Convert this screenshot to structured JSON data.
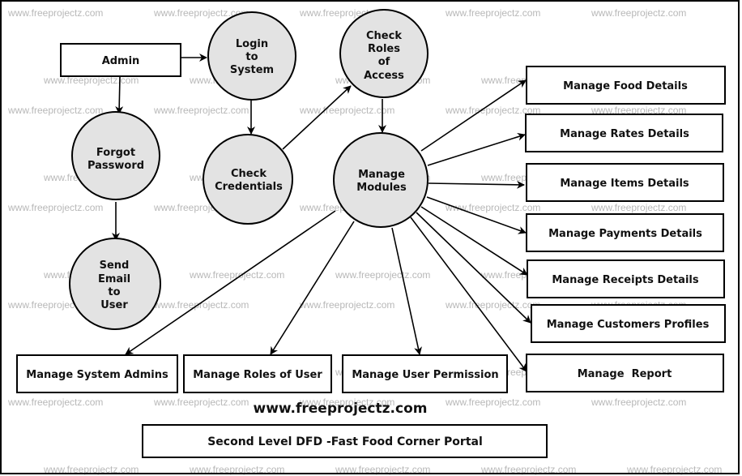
{
  "diagram": {
    "title": "Second Level DFD -Fast Food Corner Portal",
    "website": "www.freeprojectz.com",
    "watermark": "www.freeprojectz.com",
    "entities": {
      "admin": "Admin",
      "manage_food": "Manage Food Details",
      "manage_rates": "Manage Rates Details",
      "manage_items": "Manage Items Details",
      "manage_payments": "Manage Payments Details",
      "manage_receipts": "Manage Receipts Details",
      "manage_customers": "Manage Customers Profiles",
      "manage_report": "Manage  Report",
      "manage_system_admins": "Manage System Admins",
      "manage_roles": "Manage Roles of User",
      "manage_permission": "Manage User Permission"
    },
    "processes": {
      "login": [
        "Login",
        "to",
        "System"
      ],
      "check_roles": [
        "Check",
        "Roles",
        "of",
        "Access"
      ],
      "forgot_password": [
        "Forgot",
        "Password"
      ],
      "check_credentials": [
        "Check",
        "Credentials"
      ],
      "manage_modules": [
        "Manage",
        "Modules"
      ],
      "send_email": [
        "Send",
        "Email",
        "to",
        "User"
      ]
    },
    "colors": {
      "process_fill": "#e3e3e3",
      "stroke": "#000000",
      "watermark": "#b8b8b8"
    }
  }
}
